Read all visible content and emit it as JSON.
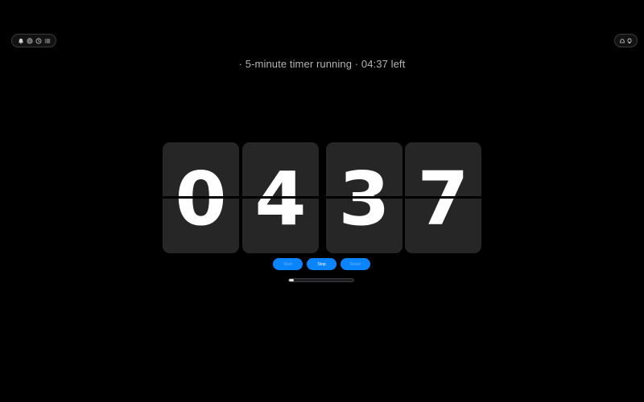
{
  "toolbar_left": {
    "items": [
      {
        "icon": "alarm-icon",
        "label": ""
      },
      {
        "icon": "stopwatch-icon",
        "label": ""
      },
      {
        "icon": "timer-icon",
        "label": ""
      },
      {
        "icon": "list-icon",
        "label": ""
      }
    ]
  },
  "toolbar_right": {
    "items": [
      {
        "icon": "theme-icon",
        "label": ""
      },
      {
        "icon": "fullscreen-icon",
        "label": ""
      }
    ]
  },
  "status": {
    "title": "· 5-minute timer running · 04:37 left"
  },
  "clock": {
    "digits": [
      "0",
      "4",
      "3",
      "7"
    ],
    "card_color": "#262626",
    "digit_color": "#ffffff"
  },
  "controls": {
    "start_label": "Start",
    "stop_label": "Stop",
    "reset_label": "Reset",
    "accent_color": "#0a84ff"
  },
  "progress": {
    "fraction_elapsed": 0.077
  }
}
